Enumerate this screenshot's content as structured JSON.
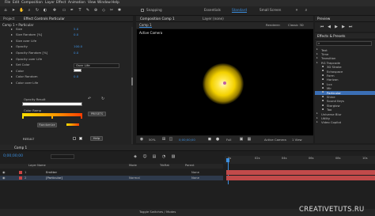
{
  "menu": [
    "File",
    "Edit",
    "Composition",
    "Layer",
    "Effect",
    "Animation",
    "View",
    "Window",
    "Help"
  ],
  "toolbar": {
    "snapping": "Snapping",
    "workspaces": [
      "Essentials",
      "Standard",
      "Small Screen"
    ]
  },
  "project_tab": "Project",
  "effect_controls_tab": "Effect Controls Particular",
  "layer_header": "Comp 1 • Particular",
  "effect_props": [
    {
      "indent": 1,
      "label": "Size",
      "value": "5.0"
    },
    {
      "indent": 1,
      "label": "Size Random [%]",
      "value": "0.0"
    },
    {
      "indent": 1,
      "label": "Size over Life",
      "value": ""
    },
    {
      "indent": 1,
      "label": "Opacity",
      "value": "100.0"
    },
    {
      "indent": 1,
      "label": "Opacity Random [%]",
      "value": "0.0"
    },
    {
      "indent": 1,
      "label": "Opacity over Life",
      "value": ""
    },
    {
      "indent": 1,
      "label": "Set Color",
      "value": "Over Life"
    },
    {
      "indent": 1,
      "label": "Color",
      "value": ""
    },
    {
      "indent": 1,
      "label": "Color Random",
      "value": "0.0"
    },
    {
      "indent": 1,
      "label": "Color over Life",
      "value": ""
    }
  ],
  "opacity_result_label": "Opacity Result",
  "color_ramp_label": "Color Ramp",
  "presets_label": "PRESETS",
  "randomize_label": "Randomize",
  "result_label": "RESULT",
  "help_label": "Help",
  "composition_tab": "Composition Comp 1",
  "layer_tab": "Layer (none)",
  "renderer_label": "Renderer:",
  "renderer_value": "Classic 3D",
  "comp_subtab": "Comp 1",
  "active_camera_overlay": "Active Camera",
  "viewer_footer": {
    "zoom": "50%",
    "timecode": "0;00;00;00",
    "resolution": "Full",
    "view": "Active Camera",
    "views": "1 View"
  },
  "preview_tab": "Preview",
  "effects_presets_tab": "Effects & Presets",
  "search_placeholder": "",
  "effects_top": [
    "Text",
    "Time",
    "Transition"
  ],
  "rg_folder": "RG Trapcode",
  "rg_items": [
    "3D Stroke",
    "Echospace",
    "Form",
    "Horizon",
    "Lux",
    "Mir",
    "Particular",
    "Shine",
    "Sound Keys",
    "Starglow",
    "Tao"
  ],
  "selected_rg_item": "Particular",
  "effects_bottom": [
    "Universe Blur",
    "Utility",
    "Video Copilot"
  ],
  "timeline_tab": "Comp 1",
  "timeline_time": "0;00;00;00",
  "timeline_cols": {
    "layer": "Layer Name",
    "mode": "Mode",
    "trkmat": "TrkMat",
    "parent": "Parent"
  },
  "layers": [
    {
      "num": "1",
      "name": "Emitter",
      "mode": "",
      "parent": "None",
      "color": "#c44"
    },
    {
      "num": "2",
      "name": "[Particular]",
      "mode": "Normal",
      "parent": "None",
      "color": "#c44"
    }
  ],
  "ruler_labels": [
    "0s",
    "02s",
    "04s",
    "06s",
    "08s",
    "10s"
  ],
  "timeline_footer": "Toggle Switches / Modes",
  "watermark": "CREATIVETUTS.RU",
  "colors": {
    "accent_blue": "#3b8fe0",
    "track_red": "#c14a4a",
    "selected": "#3b6fb6",
    "ramp_start": "#ffe000",
    "ramp_end": "#ff3d00"
  }
}
